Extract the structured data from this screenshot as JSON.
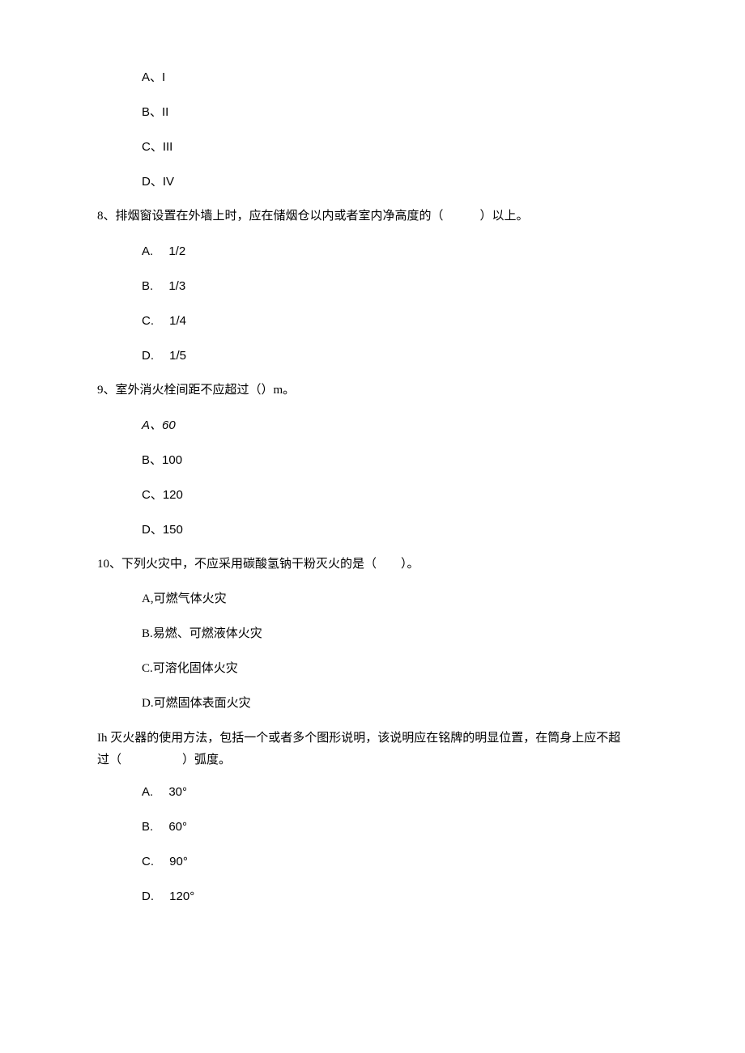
{
  "q7": {
    "options": {
      "a": "A、I",
      "b": "B、II",
      "c": "C、III",
      "d": "D、IV"
    }
  },
  "q8": {
    "stem": "8、排烟窗设置在外墙上时，应在储烟仓以内或者室内净高度的（   ）以上。",
    "options": {
      "a": "A.  1/2",
      "b": "B.  1/3",
      "c": "C.  1/4",
      "d": "D.  1/5"
    }
  },
  "q9": {
    "stem": "9、室外消火栓间距不应超过（）m。",
    "options": {
      "a": "A、60",
      "b": "B、100",
      "c": "C、120",
      "d": "D、150"
    }
  },
  "q10": {
    "stem": "10、下列火灾中，不应采用碳酸氢钠干粉灭火的是（  ）。",
    "options": {
      "a": "A,可燃气体火灾",
      "b": "B.易燃、可燃液体火灾",
      "c": "C.可溶化固体火灾",
      "d": "D.可燃固体表面火灾"
    }
  },
  "q11": {
    "stem_line1": "Ih 灭火器的使用方法，包括一个或者多个图形说明，该说明应在铭牌的明显位置，在筒身上应不超",
    "stem_line2": "过（     ）弧度。",
    "options": {
      "a": "A.  30°",
      "b": "B.  60°",
      "c": "C.  90°",
      "d": "D.  120°"
    }
  }
}
